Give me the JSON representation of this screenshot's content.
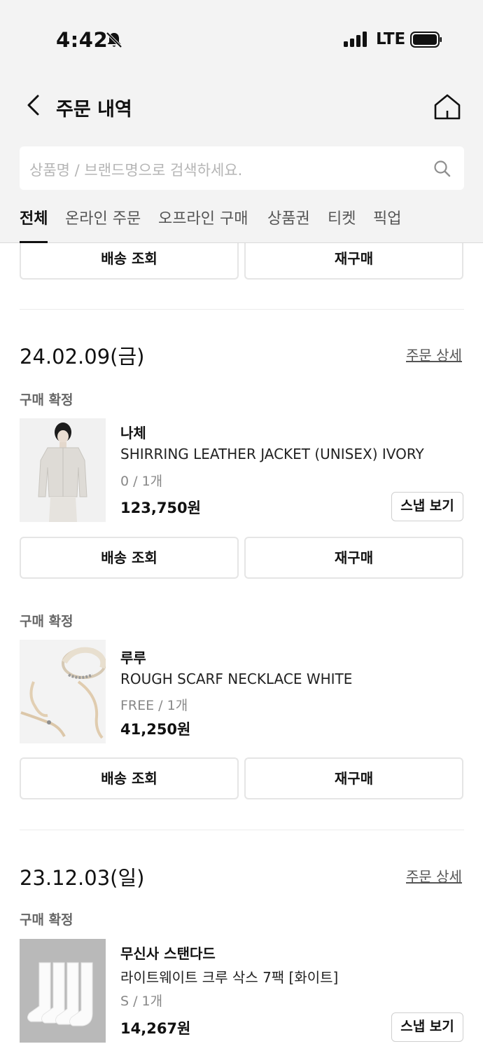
{
  "status_bar": {
    "time": "4:42",
    "network": "LTE"
  },
  "header": {
    "title": "주문 내역"
  },
  "search": {
    "placeholder": "상품명 / 브랜드명으로 검색하세요."
  },
  "tabs": [
    {
      "label": "전체"
    },
    {
      "label": "온라인 주문"
    },
    {
      "label": "오프라인 구매"
    },
    {
      "label": "상품권"
    },
    {
      "label": "티켓"
    },
    {
      "label": "픽업"
    }
  ],
  "actions": {
    "track": "배송 조회",
    "reorder": "재구매",
    "snap": "스냅 보기",
    "detail": "주문 상세"
  },
  "orders": [
    {
      "date": "24.02.09(금)",
      "items": [
        {
          "status": "구매 확정",
          "brand": "나체",
          "name": "SHIRRING LEATHER JACKET (UNISEX) IVORY",
          "option": "0 / 1개",
          "price": "123,750원"
        },
        {
          "status": "구매 확정",
          "brand": "루루",
          "name": "ROUGH SCARF NECKLACE WHITE",
          "option": "FREE / 1개",
          "price": "41,250원"
        }
      ]
    },
    {
      "date": "23.12.03(일)",
      "items": [
        {
          "status": "구매 확정",
          "brand": "무신사 스탠다드",
          "name": "라이트웨이트 크루 삭스 7팩 [화이트]",
          "option": "S / 1개",
          "price": "14,267원"
        }
      ]
    }
  ],
  "icons": [
    "bell-slash-icon",
    "signal-icon",
    "battery-icon",
    "back-chevron-icon",
    "home-icon",
    "search-icon"
  ]
}
